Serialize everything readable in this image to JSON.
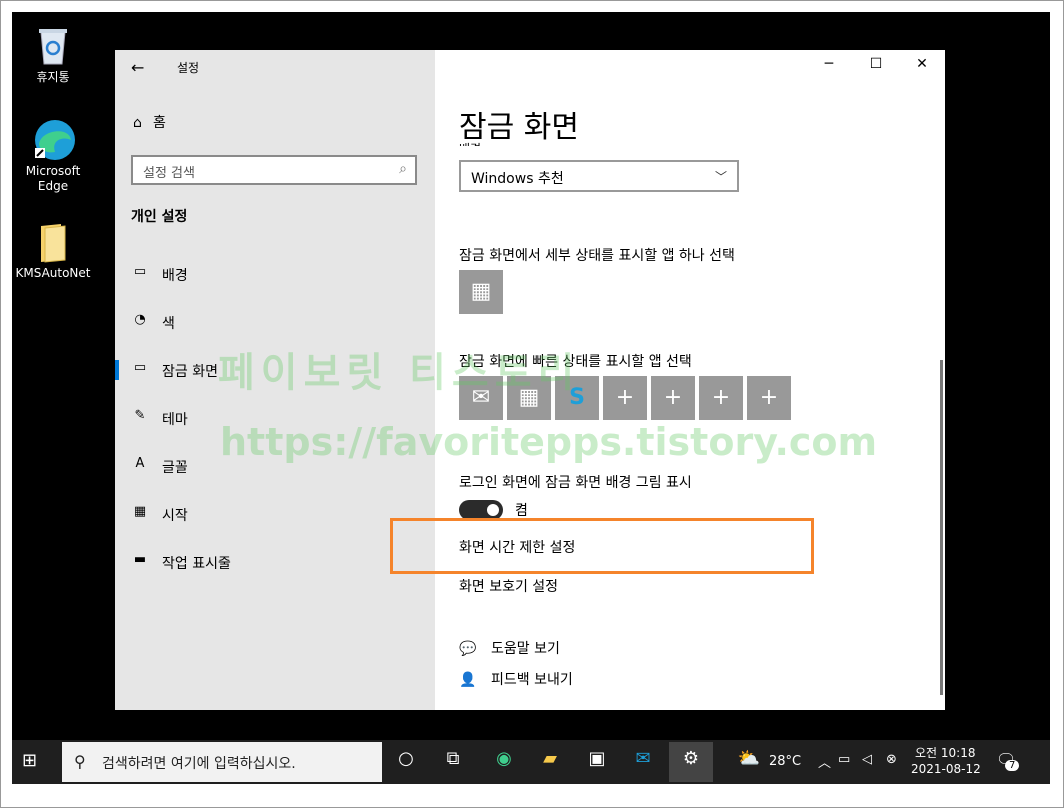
{
  "desktop": {
    "icons": [
      {
        "label": "휴지통"
      },
      {
        "label1": "Microsoft",
        "label2": "Edge"
      },
      {
        "label": "KMSAutoNet"
      }
    ]
  },
  "window": {
    "title": "설정",
    "back": "←",
    "minimize": "─",
    "maximize": "☐",
    "close": "✕"
  },
  "sidebar": {
    "home": "홈",
    "search_placeholder": "설정 검색",
    "section": "개인 설정",
    "items": [
      {
        "label": "배경",
        "icon": "▭"
      },
      {
        "label": "색",
        "icon": "◔"
      },
      {
        "label": "잠금 화면",
        "icon": "▭"
      },
      {
        "label": "테마",
        "icon": "✎"
      },
      {
        "label": "글꼴",
        "icon": "A"
      },
      {
        "label": "시작",
        "icon": "▦"
      },
      {
        "label": "작업 표시줄",
        "icon": "▬"
      }
    ]
  },
  "main": {
    "title": "잠금 화면",
    "partial_label": "배경",
    "background_dropdown": "Windows 추천",
    "detail_label": "잠금 화면에서 세부 상태를 표시할 앱 하나 선택",
    "quick_label": "잠금 화면에 빠른 상태를 표시할 앱 선택",
    "quick_tiles": [
      "✉",
      "▦",
      "S",
      "+",
      "+",
      "+",
      "+"
    ],
    "signin_label": "로그인 화면에 잠금 화면 배경 그림 표시",
    "toggle_state": "켬",
    "screen_timeout_link": "화면 시간 제한 설정",
    "screensaver_link": "화면 보호기 설정",
    "help": "도움말 보기",
    "feedback": "피드백 보내기"
  },
  "watermark": {
    "line1": "페이보릿 티스토리",
    "line2": "https://favoritepps.tistory.com"
  },
  "taskbar": {
    "search_placeholder": "검색하려면 여기에 입력하십시오.",
    "weather": "28°C",
    "time": "오전 10:18",
    "date": "2021-08-12",
    "notifications": "7"
  },
  "colors": {
    "accent": "#0078d7",
    "highlight": "#f5842b"
  }
}
